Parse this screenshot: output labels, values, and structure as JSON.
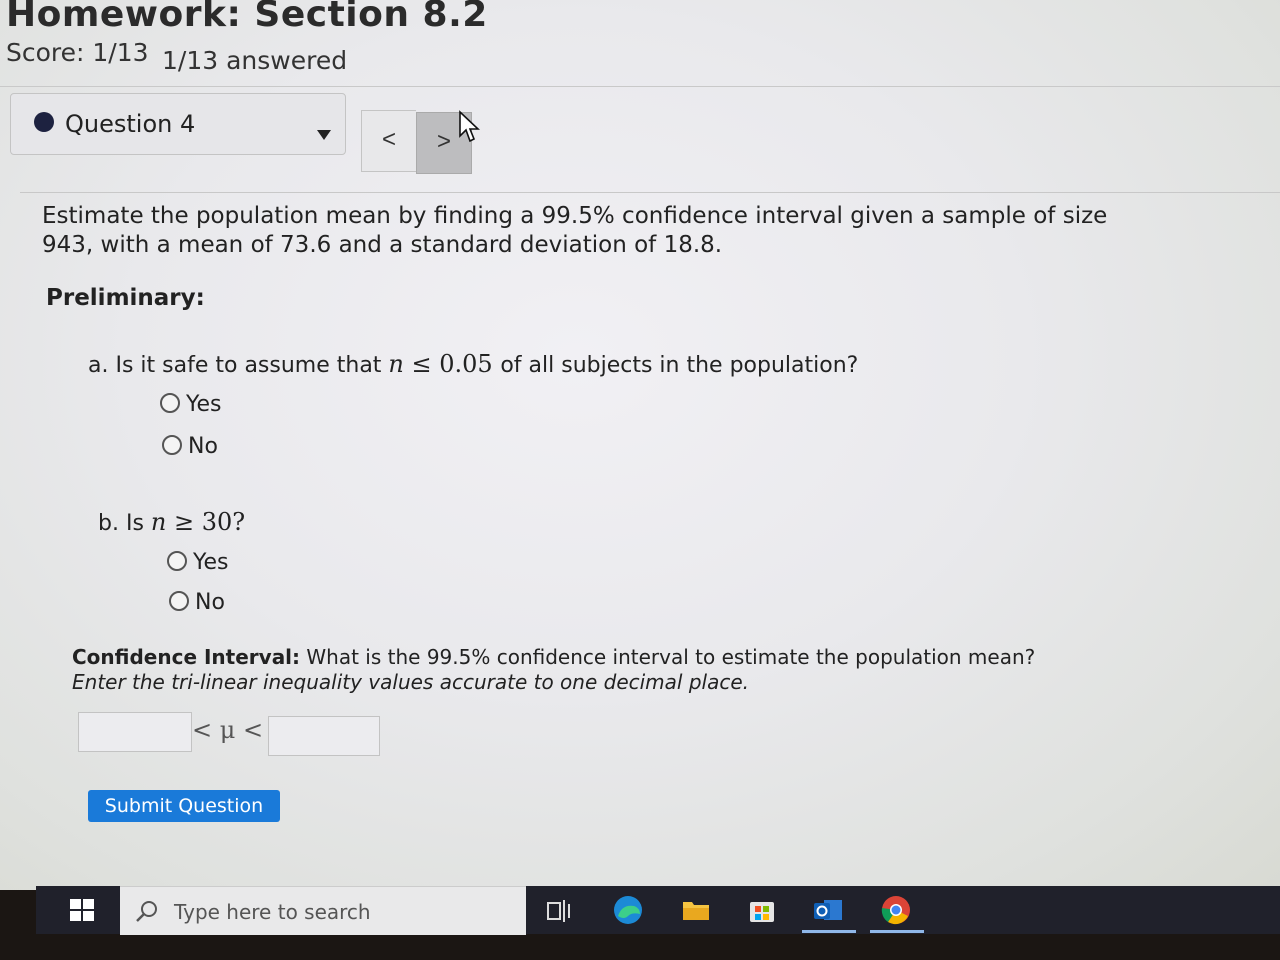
{
  "header": {
    "title": "Homework: Section 8.2",
    "score": "Score: 1/13",
    "answered": "1/13 answered"
  },
  "question_nav": {
    "label": "Question 4",
    "prev": "<",
    "next": ">"
  },
  "problem": {
    "text": "Estimate the population mean by finding a 99.5% confidence interval given a sample of size 943, with a mean of 73.6 and a standard deviation of 18.8.",
    "preliminary": "Preliminary:"
  },
  "part_a": {
    "prefix": "a. Is it safe to assume that ",
    "var": "n",
    "op": " ≤ 0.05 ",
    "suffix": "of all subjects in the population?",
    "options": [
      "Yes",
      "No"
    ]
  },
  "part_b": {
    "prefix": "b. Is ",
    "var": "n",
    "op": " ≥ 30?",
    "options": [
      "Yes",
      "No"
    ]
  },
  "confidence_interval": {
    "label": "Confidence Interval:",
    "question": " What is the 99.5% confidence interval to estimate the population mean? ",
    "instruction": "Enter the tri-linear inequality values accurate to one decimal place.",
    "inequality": "< μ <",
    "lower_value": "",
    "upper_value": ""
  },
  "submit_label": "Submit Question",
  "taskbar": {
    "search_placeholder": "Type here to search",
    "icons": [
      "windows-start-icon",
      "task-view-icon",
      "edge-icon",
      "file-explorer-icon",
      "microsoft-store-icon",
      "outlook-icon",
      "chrome-icon"
    ]
  }
}
